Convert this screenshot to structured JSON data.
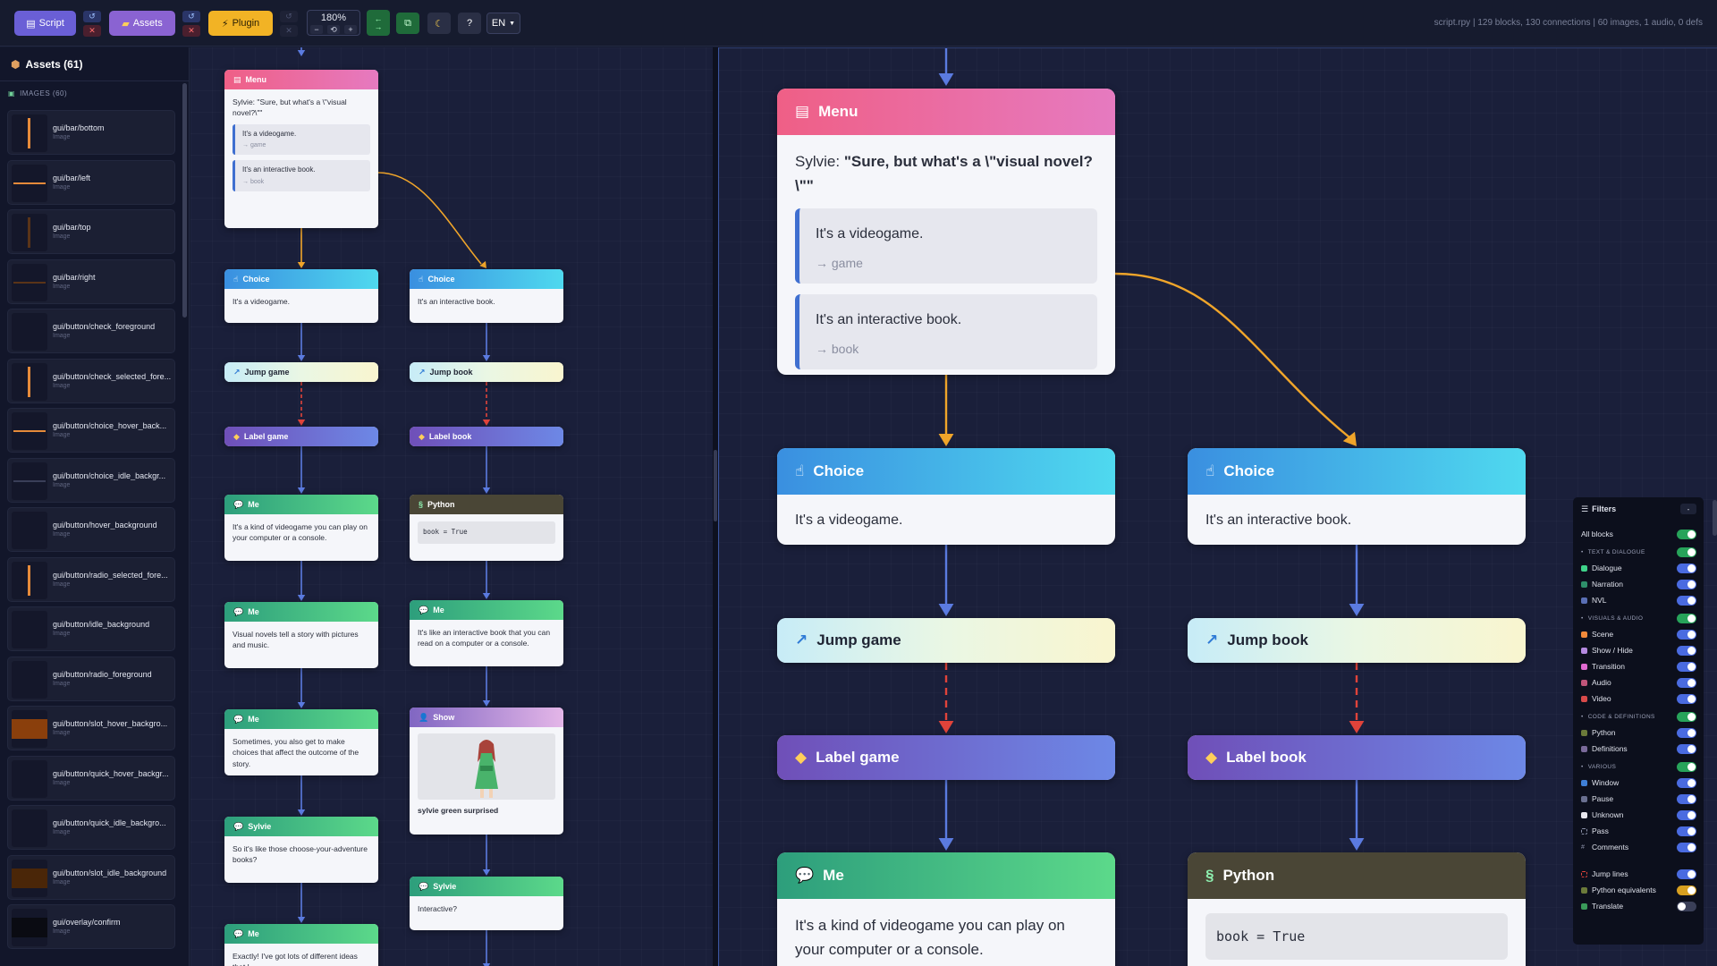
{
  "toolbar": {
    "script_label": "Script",
    "assets_label": "Assets",
    "plugin_label": "Plugin",
    "zoom": "180%",
    "zoom_minus": "−",
    "zoom_reset": "⟲",
    "zoom_plus": "+",
    "help": "?",
    "lang": "EN",
    "stats": "script.rpy | 129 blocks, 130 connections | 60 images, 1 audio, 0 defs"
  },
  "sidebar": {
    "title": "Assets (61)",
    "section": "IMAGES (60)",
    "type_label": "Image",
    "items": [
      {
        "name": "gui/bar/bottom",
        "thumb": "vbar",
        "color": "#e58a3a"
      },
      {
        "name": "gui/bar/left",
        "thumb": "hbar",
        "color": "#e58a3a"
      },
      {
        "name": "gui/bar/top",
        "thumb": "vbar",
        "color": "#5a3418"
      },
      {
        "name": "gui/bar/right",
        "thumb": "hbar",
        "color": "#5a3418"
      },
      {
        "name": "gui/button/check_foreground",
        "thumb": "empty",
        "color": "#14172a"
      },
      {
        "name": "gui/button/check_selected_fore...",
        "thumb": "vbar",
        "color": "#e58a3a"
      },
      {
        "name": "gui/button/choice_hover_back...",
        "thumb": "hbar",
        "color": "#e58a3a"
      },
      {
        "name": "gui/button/choice_idle_backgr...",
        "thumb": "hbar",
        "color": "#3a3f58"
      },
      {
        "name": "gui/button/hover_background",
        "thumb": "empty",
        "color": "#14172a"
      },
      {
        "name": "gui/button/radio_selected_fore...",
        "thumb": "vbar",
        "color": "#e58a3a"
      },
      {
        "name": "gui/button/idle_background",
        "thumb": "empty",
        "color": "#14172a"
      },
      {
        "name": "gui/button/radio_foreground",
        "thumb": "empty",
        "color": "#14172a"
      },
      {
        "name": "gui/button/slot_hover_backgro...",
        "thumb": "block",
        "color": "#8a3f0c"
      },
      {
        "name": "gui/button/quick_hover_backgr...",
        "thumb": "empty",
        "color": "#14172a"
      },
      {
        "name": "gui/button/quick_idle_backgro...",
        "thumb": "empty",
        "color": "#14172a"
      },
      {
        "name": "gui/button/slot_idle_background",
        "thumb": "block",
        "color": "#4a2608"
      },
      {
        "name": "gui/overlay/confirm",
        "thumb": "block",
        "color": "#0a0b12"
      }
    ]
  },
  "left_graph": {
    "menu": {
      "title": "Menu",
      "speaker": "Sylvie:",
      "line": "\"Sure, but what's a \\\"visual novel?\\\"\"",
      "options": [
        {
          "text": "It's a videogame.",
          "target": "→ game"
        },
        {
          "text": "It's an interactive book.",
          "target": "→ book"
        }
      ]
    },
    "choice_a": {
      "title": "Choice",
      "text": "It's a videogame."
    },
    "choice_b": {
      "title": "Choice",
      "text": "It's an interactive book."
    },
    "jump_a": {
      "title": "Jump game"
    },
    "jump_b": {
      "title": "Jump book"
    },
    "label_a": {
      "title": "Label game"
    },
    "label_b": {
      "title": "Label book"
    },
    "me1": {
      "title": "Me",
      "text": "It's a kind of videogame you can play on your computer or a console."
    },
    "python": {
      "title": "Python",
      "code": "book = True"
    },
    "me2": {
      "title": "Me",
      "text": "Visual novels tell a story with pictures and music."
    },
    "me_b": {
      "title": "Me",
      "text": "It's like an interactive book that you can read on a computer or a console."
    },
    "me3": {
      "title": "Me",
      "text": "Sometimes, you also get to make choices that affect the outcome of the story."
    },
    "show": {
      "title": "Show",
      "caption": "sylvie green surprised"
    },
    "sylvie1": {
      "title": "Sylvie",
      "text": "So it's like those choose-your-adventure books?"
    },
    "sylvie2": {
      "title": "Sylvie",
      "text": "Interactive?"
    },
    "me4": {
      "title": "Me",
      "text": "Exactly! I've got lots of different ideas that I"
    }
  },
  "right_graph": {
    "menu": {
      "title": "Menu",
      "speaker": "Sylvie:",
      "line": "\"Sure, but what's a \\\"visual novel?\\\"\"",
      "options": [
        {
          "text": "It's a videogame.",
          "target": "→ game"
        },
        {
          "text": "It's an interactive book.",
          "target": "→ book"
        }
      ]
    },
    "choice_a": {
      "title": "Choice",
      "text": "It's a videogame."
    },
    "choice_b": {
      "title": "Choice",
      "text": "It's an interactive book."
    },
    "jump_a": {
      "title": "Jump game"
    },
    "jump_b": {
      "title": "Jump book"
    },
    "label_a": {
      "title": "Label game"
    },
    "label_b": {
      "title": "Label book"
    },
    "me1": {
      "title": "Me",
      "text": "It's a kind of videogame you can play on your computer or a console."
    },
    "python": {
      "title": "Python",
      "code": "book = True"
    }
  },
  "filters": {
    "title": "Filters",
    "collapse": "-",
    "all_blocks": "All blocks",
    "sections": {
      "text": "TEXT & DIALOGUE",
      "visual": "VISUALS & AUDIO",
      "code": "CODE & DEFINITIONS",
      "various": "VARIOUS"
    },
    "items": {
      "dialogue": "Dialogue",
      "narration": "Narration",
      "nvl": "NVL",
      "scene": "Scene",
      "showhide": "Show / Hide",
      "transition": "Transition",
      "audio": "Audio",
      "video": "Video",
      "python": "Python",
      "definitions": "Definitions",
      "window": "Window",
      "pause": "Pause",
      "unknown": "Unknown",
      "pass": "Pass",
      "comments": "Comments",
      "jumplines": "Jump lines",
      "pyequiv": "Python equivalents",
      "translate": "Translate"
    }
  },
  "colors": {
    "menu": "#ef5f86",
    "choice": "#3a8fe0",
    "label": "#6f4fb8",
    "say": "#2d9e7c",
    "python": "#4a4636",
    "edge_flow": "#5b7be0",
    "edge_menu": "#f0a52a",
    "edge_jump": "#e0433a"
  }
}
